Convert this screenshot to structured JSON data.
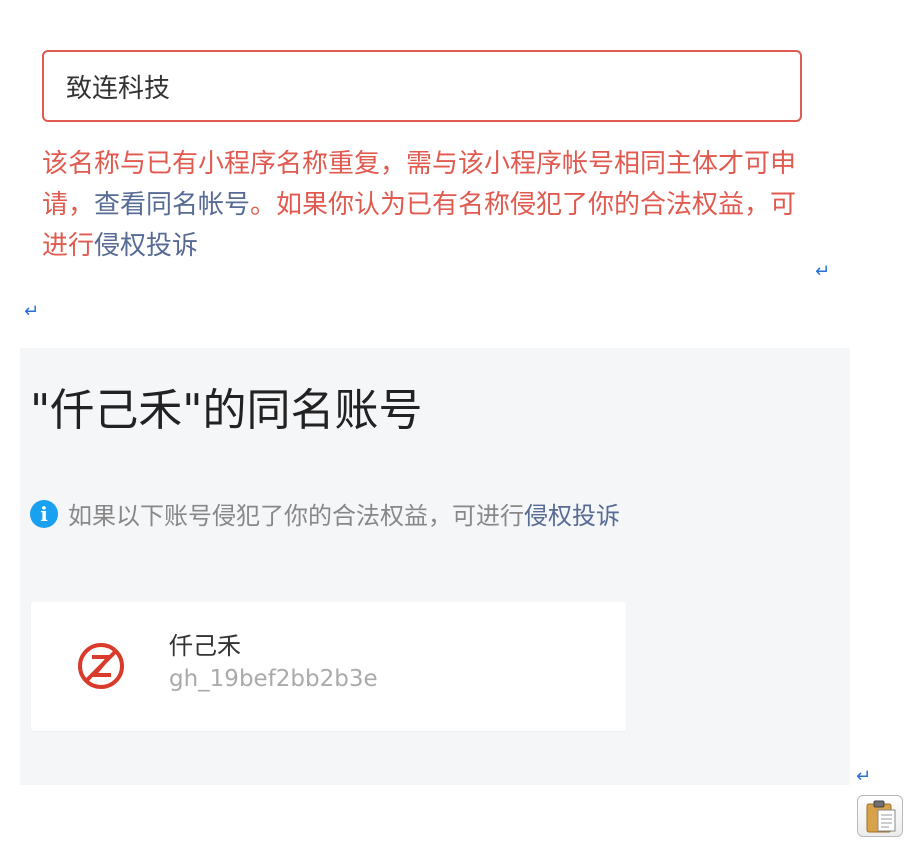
{
  "name_input": {
    "value": "致连科技"
  },
  "error": {
    "text_before_link": "该名称与已有小程序名称重复，需与该小程序帐号相同主体才可申请，",
    "view_same_name_link": "查看同名帐号",
    "text_middle": "。如果你认为已有名称侵犯了你的合法权益，可进行",
    "complaint_link": "侵权投诉"
  },
  "panel": {
    "title": "\"仟己禾\"的同名账号",
    "notice_text": "如果以下账号侵犯了你的合法权益，可进行",
    "notice_link": "侵权投诉",
    "accounts": [
      {
        "name": "仟己禾",
        "id": "gh_19bef2bb2b3e",
        "avatar_icon": "brand-logo-icon"
      }
    ]
  },
  "colors": {
    "error_red": "#e05a50",
    "link_blue": "#576b95",
    "info_blue": "#1aa0f0",
    "panel_bg": "#f5f6f8"
  },
  "icons": {
    "return_mark": "↵",
    "info": "i"
  }
}
